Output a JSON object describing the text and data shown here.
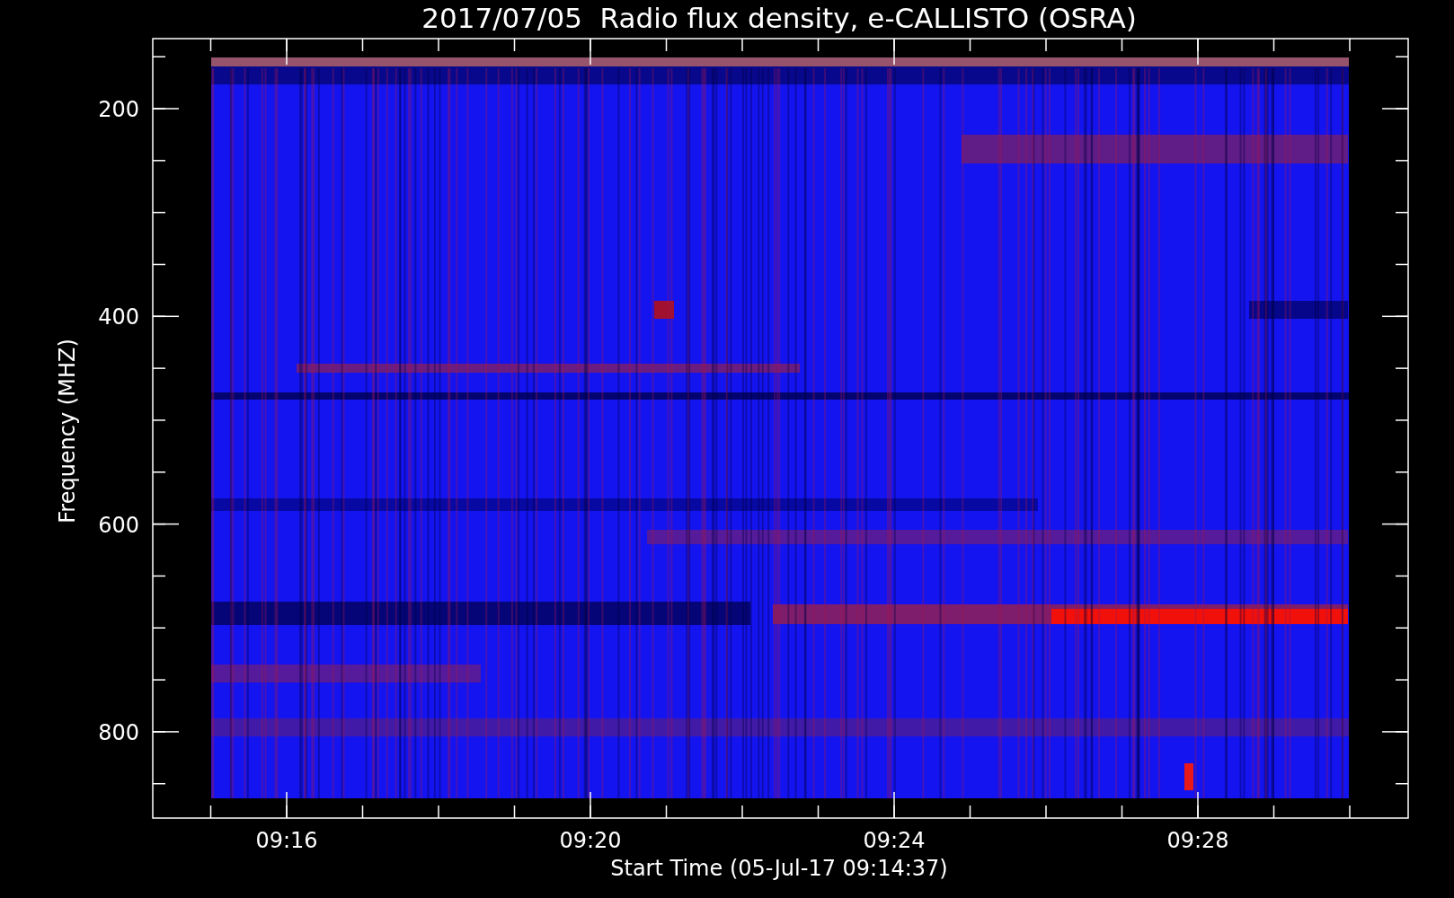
{
  "title": "2017/07/05  Radio flux density, e-CALLISTO (OSRA)",
  "y_axis": {
    "label": "Frequency (MHZ)",
    "ticks": [
      "200",
      "400",
      "600",
      "800"
    ]
  },
  "x_axis": {
    "label": "Start Time (05-Jul-17 09:14:37)",
    "ticks": [
      "09:16",
      "09:20",
      "09:24",
      "09:28"
    ]
  }
}
